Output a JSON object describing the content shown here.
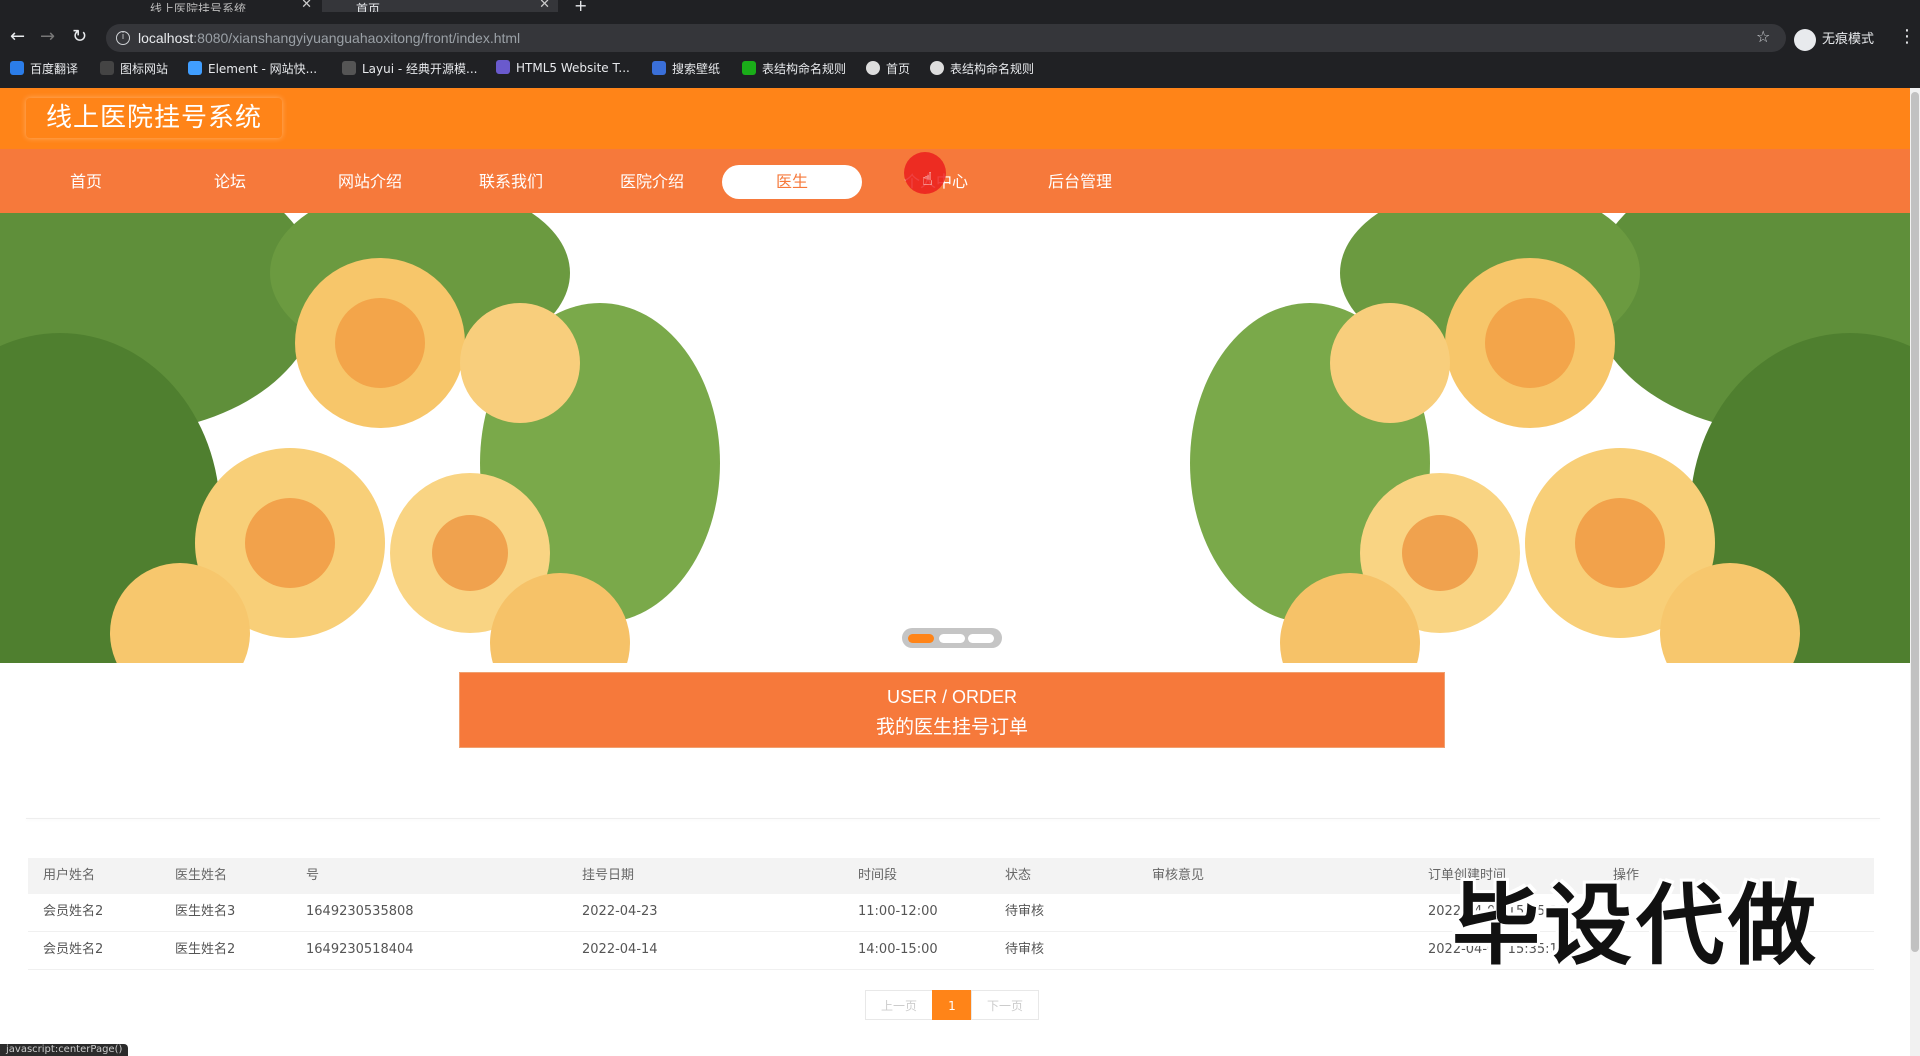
{
  "browser": {
    "tabs": [
      {
        "title": "线上医院挂号系统"
      },
      {
        "title": "首页"
      }
    ],
    "url_host": "localhost",
    "url_path": ":8080/xianshangyiyuanguahaoxitong/front/index.html",
    "incognito_label": "无痕模式",
    "bookmarks": [
      "百度翻译",
      "图标网站",
      "Element - 网站快...",
      "Layui - 经典开源模...",
      "HTML5 Website T...",
      "搜索壁纸",
      "表结构命名规则",
      "首页",
      "表结构命名规则"
    ]
  },
  "site": {
    "title": "线上医院挂号系统"
  },
  "nav": {
    "items": [
      "首页",
      "论坛",
      "网站介绍",
      "联系我们",
      "医院介绍",
      "医生",
      "个人中心",
      "后台管理"
    ],
    "active": "医生"
  },
  "banner": {
    "slide_count": 3,
    "active_slide": 1
  },
  "section": {
    "title_en": "USER / ORDER",
    "title_cn": "我的医生挂号订单"
  },
  "table": {
    "headers": [
      "用户姓名",
      "医生姓名",
      "号",
      "挂号日期",
      "时间段",
      "状态",
      "审核意见",
      "订单创建时间",
      "操作"
    ],
    "rows": [
      {
        "user": "会员姓名2",
        "doctor": "医生姓名3",
        "number": "1649230535808",
        "date": "2022-04-23",
        "slot": "11:00-12:00",
        "status": "待审核",
        "remark": "",
        "created": "2022-04-06 15:35:36"
      },
      {
        "user": "会员姓名2",
        "doctor": "医生姓名2",
        "number": "1649230518404",
        "date": "2022-04-14",
        "slot": "14:00-15:00",
        "status": "待审核",
        "remark": "",
        "created": "2022-04-06 15:35:18"
      }
    ]
  },
  "pager": {
    "prev": "上一页",
    "current": "1",
    "next": "下一页"
  },
  "watermark": "毕设代做",
  "status_url": "javascript:centerPage()",
  "colors": {
    "header": "#ff8418",
    "navbar": "#f6793b",
    "browser_chrome": "#202124"
  }
}
